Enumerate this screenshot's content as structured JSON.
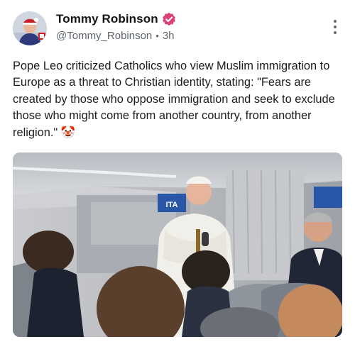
{
  "post": {
    "author": {
      "display_name": "Tommy Robinson",
      "handle": "@Tommy_Robinson",
      "verified": true,
      "verified_color": "#d9417a"
    },
    "separator": "•",
    "timestamp": "3h",
    "menu_icon": "more-vertical-icon",
    "text": "Pope Leo criticized Catholics who view Muslim immigration to Europe as a threat to Christian identity, stating: \"Fears are created by those who oppose immigration and seek to exclude those who might come from another country, from another religion.\" 🤡",
    "media": {
      "type": "photo",
      "sign_text": "ITA"
    }
  }
}
